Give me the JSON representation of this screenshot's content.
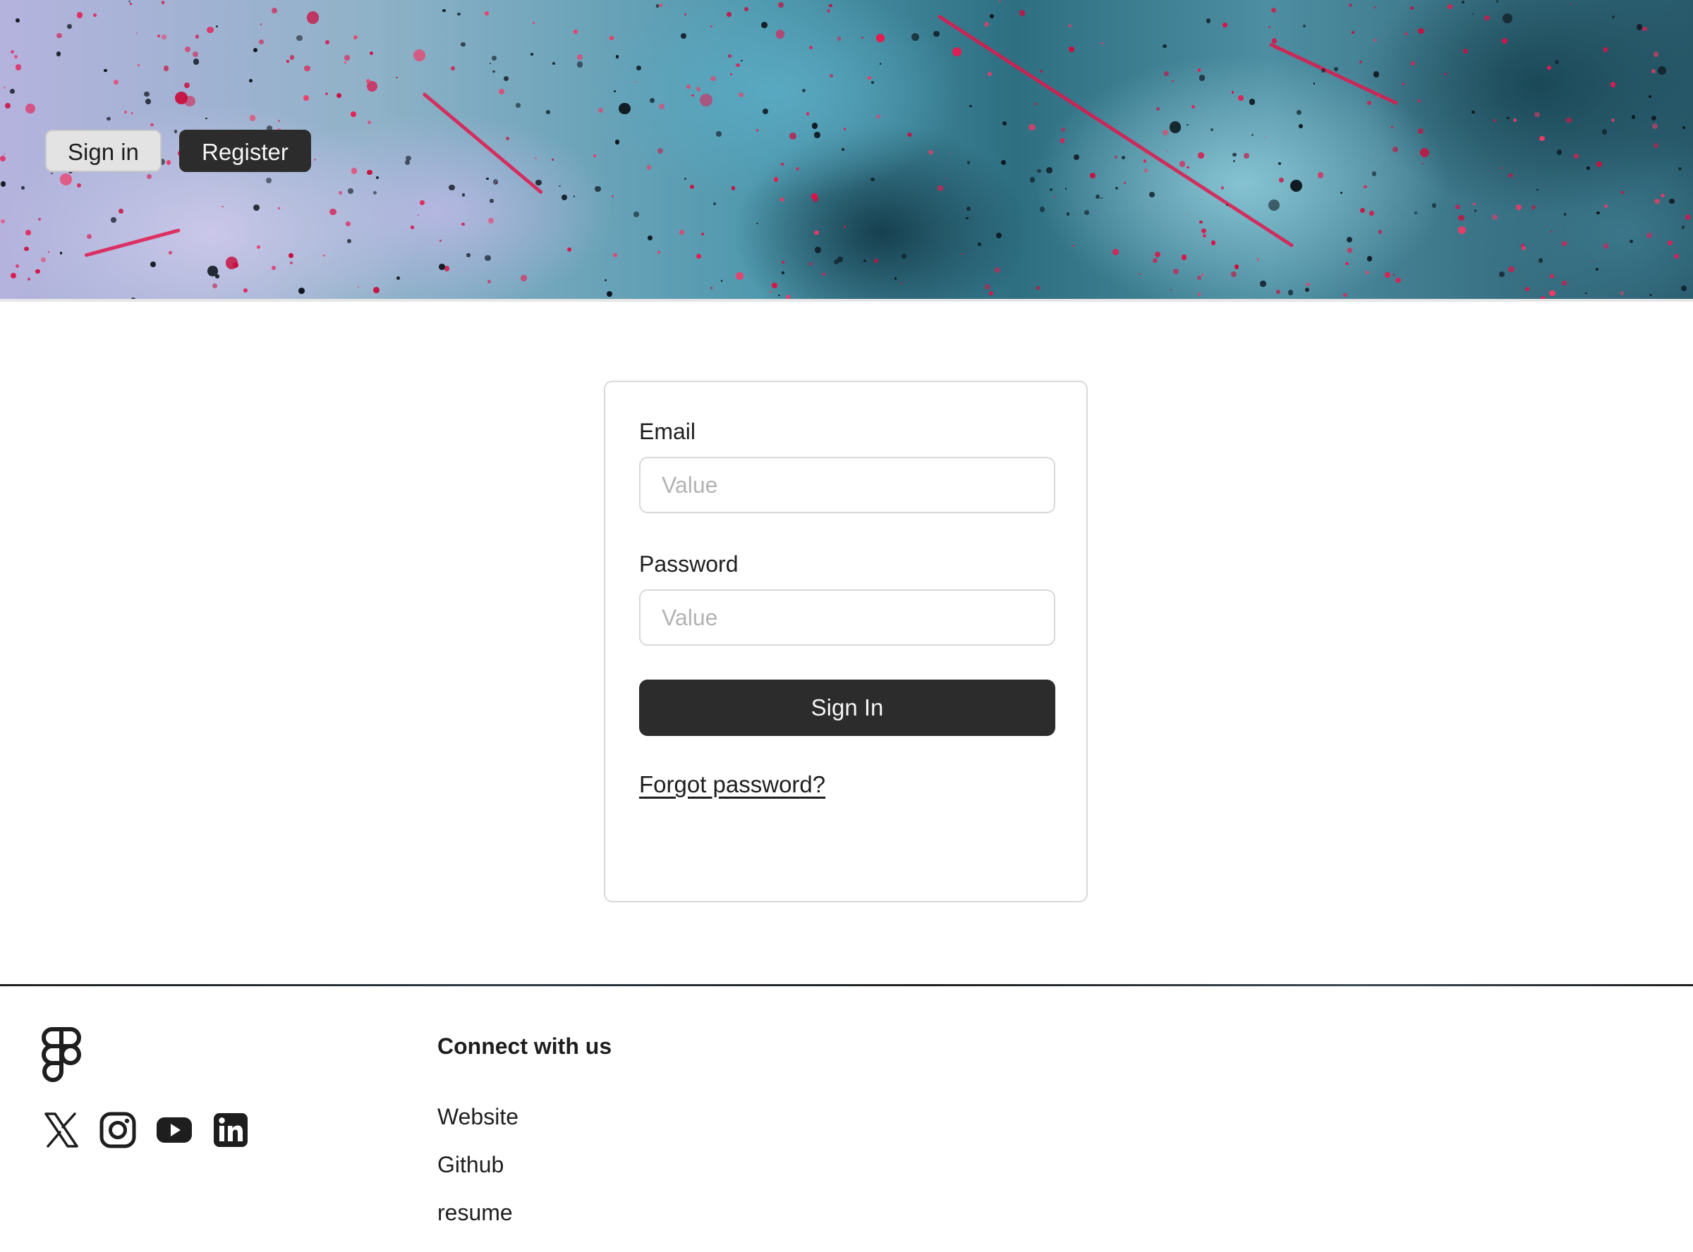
{
  "header": {
    "sign_in_label": "Sign in",
    "register_label": "Register"
  },
  "form": {
    "email_label": "Email",
    "email_placeholder": "Value",
    "password_label": "Password",
    "password_placeholder": "Value",
    "submit_label": "Sign In",
    "forgot_label": "Forgot password?"
  },
  "footer": {
    "logo_icon": "figma-logo-icon",
    "social_icons": [
      "x-icon",
      "instagram-icon",
      "youtube-icon",
      "linkedin-icon"
    ],
    "heading": "Connect with us",
    "links": [
      "Website",
      "Github",
      "resume"
    ]
  },
  "colors": {
    "primary_button": "#2c2c2c",
    "secondary_button": "#e3e3e3",
    "border": "#d9d9d9",
    "placeholder": "#b3b3b3",
    "text": "#1e1e1e"
  }
}
